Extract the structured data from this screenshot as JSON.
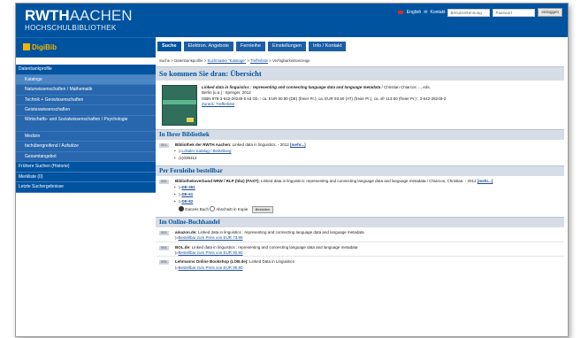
{
  "header": {
    "logo_main": "RWTH",
    "logo_aachen": "AACHEN",
    "logo_sub": "HOCHSCHULBIBLIOTHEK",
    "lang_label": "English",
    "contact_label": "Kontakt",
    "username_placeholder": "Benutzerkennung",
    "password_placeholder": "Passwort",
    "login_button": "einloggen"
  },
  "digibib": {
    "logo": "DigiBib"
  },
  "nav": {
    "tabs": [
      "Suche",
      "Elektron. Angebote",
      "Fernleihe",
      "Einstellungen",
      "Info / Kontakt"
    ]
  },
  "breadcrumb": {
    "start": "Suche > Datenbankprofile >",
    "l1": "Suchmaske \"Kataloge\"",
    "sep1": ">",
    "l2": "Trefferliste",
    "end": "> Verfügbarkeitsanzeige"
  },
  "sidebar": {
    "items": [
      "Datenbankprofile",
      "Kataloge",
      "Naturwissenschaften / Mathematik",
      "Technik + Geowissenschaften",
      "Geisteswissenschaften",
      "Wirtschafts- und Sozialwissenschaften / Psychologie",
      "Medizin",
      "fachübergreifend / Aufsätze",
      "Gesamtangebot",
      "Frühere Suchen (Historie)",
      "Merkliste (0)",
      "Letzte Suchergebnisse"
    ]
  },
  "overview": {
    "heading": "So kommen Sie dran: Übersicht",
    "title": "Linked data in linguistics : representing and connecting language data and language metadata",
    "author": " / Christian Chiarcos ..., eds.",
    "publisher": "Berlin [u.a.] : Springer, 2012",
    "isbn": "ISBN 978-3-642-28248-5 kd Gb. : ca. EUR 90.90 (DE) (freier Pr.), ca. EUR 93.50 (AT) (freier Pr.), ca. sfr 113.50 (freier Pr.) ; 3-642-28248-2",
    "back_link": "Zurück: Trefferliste"
  },
  "library": {
    "heading": "In Ihrer Bibliothek",
    "num": "001.",
    "name": "Bibliothek der RWTH Aachen:",
    "text": " Linked data in linguistics. - 2012 ",
    "more": "[mehr...]",
    "location_link": "Lokaler Katalog / Bestellung",
    "signature": "(1)038312"
  },
  "fernleihe": {
    "heading": "Per Fernleihe bestellbar",
    "num": "002.",
    "name": "Bibliotheksverbund NRW / RLP (hbz) (FAST):",
    "text": " Linked data in linguistics: representing and connecting language data and language metadata / Chiarcos, Christian. - 2012 ",
    "more": "[mehr...]",
    "links": [
      "DE-361",
      "DE-61",
      "DE-82"
    ],
    "opt_whole": "Ganzes Buch",
    "opt_copy": "Abschnitt in Kopie",
    "order_button": "Bestellen"
  },
  "online": {
    "heading": "Im Online-Buchhandel",
    "shops": [
      {
        "num": "003.",
        "name": "amazon.de:",
        "text": " Linked data in linguistics : representing and connecting language data and language metadata",
        "price_link": "Bestellbar zum Preis von EUR 73.99"
      },
      {
        "num": "004.",
        "name": "BOL.de:",
        "text": " Linked data in linguistics : representing and connecting language data and language metadata",
        "price_link": "Bestellbar zum Preis von EUR 90.90"
      },
      {
        "num": "005.",
        "name": "Lehmanns Online Bookshop (LOB.de):",
        "text": " Linked Data in Linguistics",
        "price_link": "Bestellbar zum Preis von EUR 90.90"
      }
    ]
  },
  "colors": {
    "brand": "#00539f",
    "section_bg": "#d7dde6",
    "link": "#1a4e9a"
  }
}
